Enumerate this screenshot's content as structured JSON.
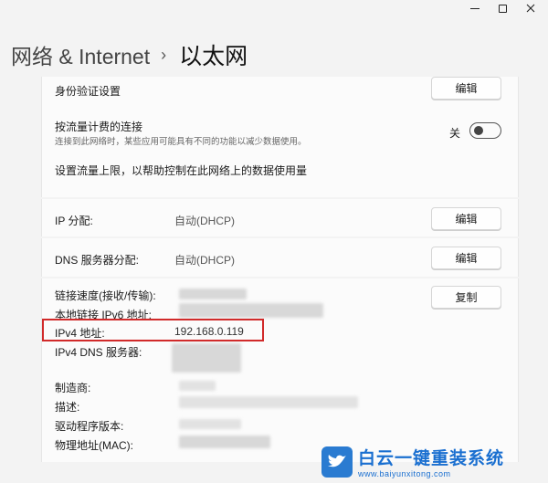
{
  "breadcrumb": {
    "parent": "网络 & Internet",
    "separator": "›",
    "current": "以太网"
  },
  "auth": {
    "label": "身份验证设置",
    "button": "编辑"
  },
  "metered": {
    "label": "按流量计费的连接",
    "description": "连接到此网络时，某些应用可能具有不同的功能以减少数据使用。",
    "toggle_state_label": "关",
    "toggle_on": false,
    "link": "设置流量上限，以帮助控制在此网络上的数据使用量"
  },
  "ip_assignment": {
    "label": "IP 分配:",
    "value": "自动(DHCP)",
    "button": "编辑"
  },
  "dns_assignment": {
    "label": "DNS 服务器分配:",
    "value": "自动(DHCP)",
    "button": "编辑"
  },
  "properties": {
    "copy_button": "复制",
    "rows": [
      {
        "label": "链接速度(接收/传输):",
        "value": ""
      },
      {
        "label": "本地链接 IPv6 地址:",
        "value": ""
      },
      {
        "label": "IPv4 地址:",
        "value": "192.168.0.119"
      },
      {
        "label": "IPv4 DNS 服务器:",
        "value": ""
      },
      {
        "label": "制造商:",
        "value": ""
      },
      {
        "label": "描述:",
        "value": ""
      },
      {
        "label": "驱动程序版本:",
        "value": ""
      },
      {
        "label": "物理地址(MAC):",
        "value": ""
      }
    ]
  },
  "watermark": {
    "title": "白云一键重装系统",
    "url": "www.baiyunxitong.com"
  },
  "colors": {
    "highlight": "#d12a2a",
    "watermark_blue": "#1a6fd0"
  }
}
